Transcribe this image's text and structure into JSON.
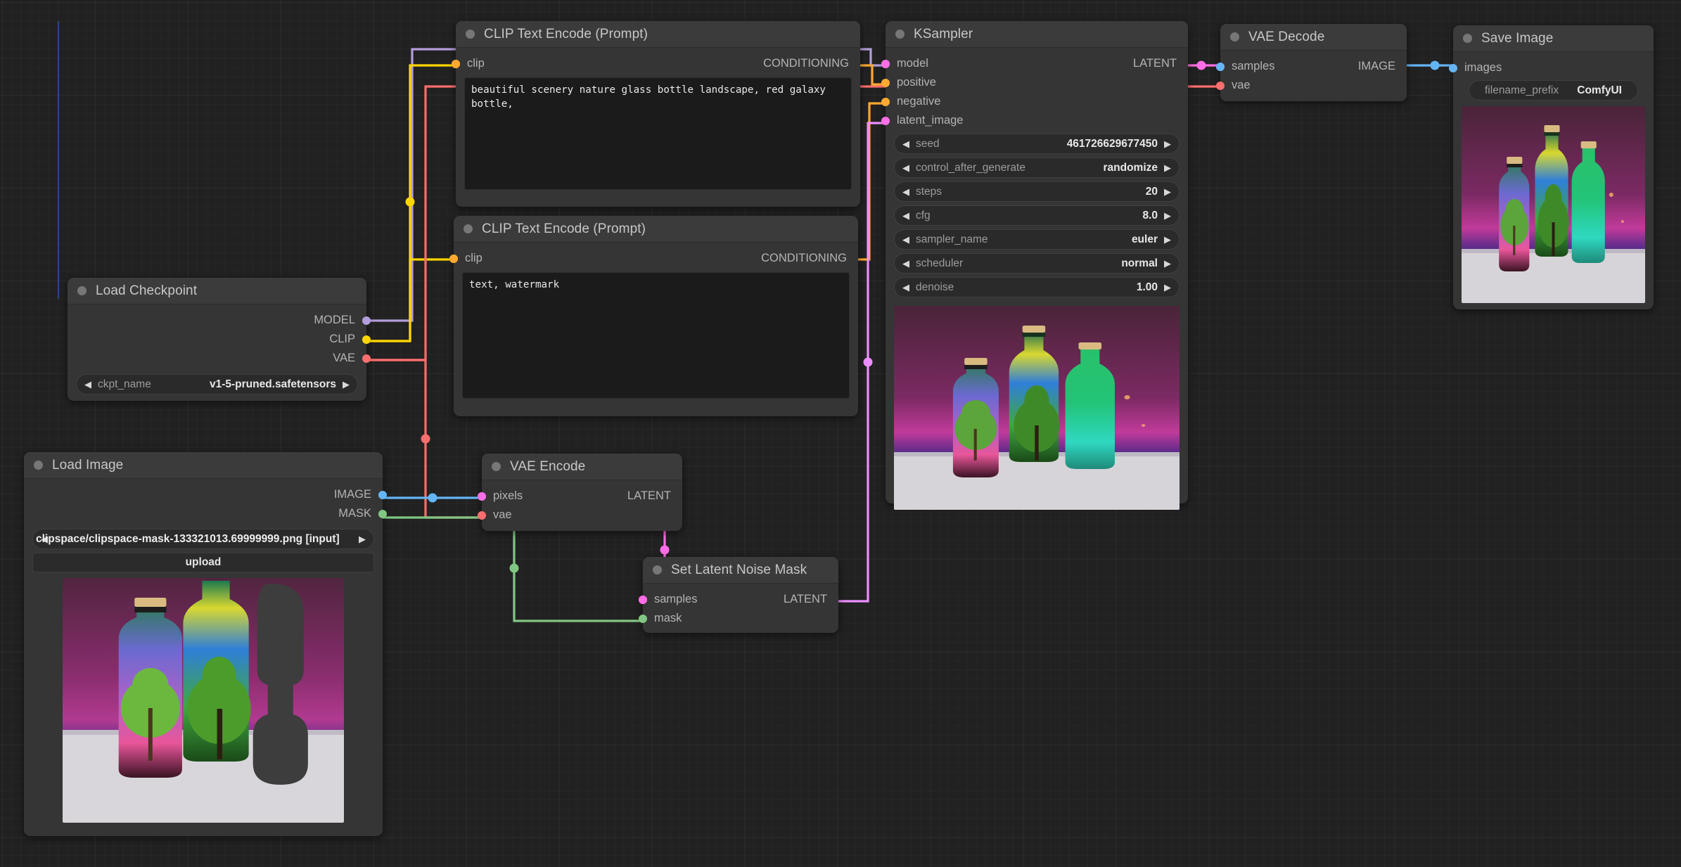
{
  "app": {
    "name": "ComfyUI",
    "canvas_bg": "#212121",
    "node_bg": "#353535",
    "header_bg": "#3b3b3b"
  },
  "colors": {
    "model": "#b39ddb",
    "clip": "#ffd500",
    "vae": "#ff6e6e",
    "conditioning": "#ffa931",
    "latent": "#ff6ee6",
    "image": "#64b5f6",
    "mask": "#81c784"
  },
  "nodes": {
    "clip_positive": {
      "title": "CLIP Text Encode (Prompt)",
      "inputs": [
        {
          "label": "clip",
          "type": "clip"
        }
      ],
      "outputs": [
        {
          "label": "CONDITIONING",
          "type": "conditioning"
        }
      ],
      "text": "beautiful scenery nature glass bottle landscape, red galaxy bottle,"
    },
    "clip_negative": {
      "title": "CLIP Text Encode (Prompt)",
      "inputs": [
        {
          "label": "clip",
          "type": "clip"
        }
      ],
      "outputs": [
        {
          "label": "CONDITIONING",
          "type": "conditioning"
        }
      ],
      "text": "text, watermark"
    },
    "ksampler": {
      "title": "KSampler",
      "inputs": [
        {
          "label": "model",
          "type": "model"
        },
        {
          "label": "positive",
          "type": "conditioning"
        },
        {
          "label": "negative",
          "type": "conditioning"
        },
        {
          "label": "latent_image",
          "type": "latent"
        }
      ],
      "outputs": [
        {
          "label": "LATENT",
          "type": "latent"
        }
      ],
      "widgets": [
        {
          "name": "seed",
          "value": "461726629677450"
        },
        {
          "name": "control_after_generate",
          "value": "randomize"
        },
        {
          "name": "steps",
          "value": "20"
        },
        {
          "name": "cfg",
          "value": "8.0"
        },
        {
          "name": "sampler_name",
          "value": "euler"
        },
        {
          "name": "scheduler",
          "value": "normal"
        },
        {
          "name": "denoise",
          "value": "1.00"
        }
      ]
    },
    "vae_decode": {
      "title": "VAE Decode",
      "inputs": [
        {
          "label": "samples",
          "type": "latent"
        },
        {
          "label": "vae",
          "type": "vae"
        }
      ],
      "outputs": [
        {
          "label": "IMAGE",
          "type": "image"
        }
      ]
    },
    "save_image": {
      "title": "Save Image",
      "inputs": [
        {
          "label": "images",
          "type": "image"
        }
      ],
      "widgets": [
        {
          "name": "filename_prefix",
          "value": "ComfyUI"
        }
      ]
    },
    "load_checkpoint": {
      "title": "Load Checkpoint",
      "outputs": [
        {
          "label": "MODEL",
          "type": "model"
        },
        {
          "label": "CLIP",
          "type": "clip"
        },
        {
          "label": "VAE",
          "type": "vae"
        }
      ],
      "widgets": [
        {
          "name": "ckpt_name",
          "value": "v1-5-pruned.safetensors"
        }
      ]
    },
    "load_image": {
      "title": "Load Image",
      "outputs": [
        {
          "label": "IMAGE",
          "type": "image"
        },
        {
          "label": "MASK",
          "type": "mask"
        }
      ],
      "widgets": [
        {
          "name": "image",
          "value": "clipspace/clipspace-mask-133321013.69999999.png [input]"
        }
      ],
      "upload_label": "upload"
    },
    "vae_encode": {
      "title": "VAE Encode",
      "inputs": [
        {
          "label": "pixels",
          "type": "image"
        },
        {
          "label": "vae",
          "type": "vae"
        }
      ],
      "outputs": [
        {
          "label": "LATENT",
          "type": "latent"
        }
      ]
    },
    "set_latent_noise_mask": {
      "title": "Set Latent Noise Mask",
      "inputs": [
        {
          "label": "samples",
          "type": "latent"
        },
        {
          "label": "mask",
          "type": "mask"
        }
      ],
      "outputs": [
        {
          "label": "LATENT",
          "type": "latent"
        }
      ]
    }
  }
}
